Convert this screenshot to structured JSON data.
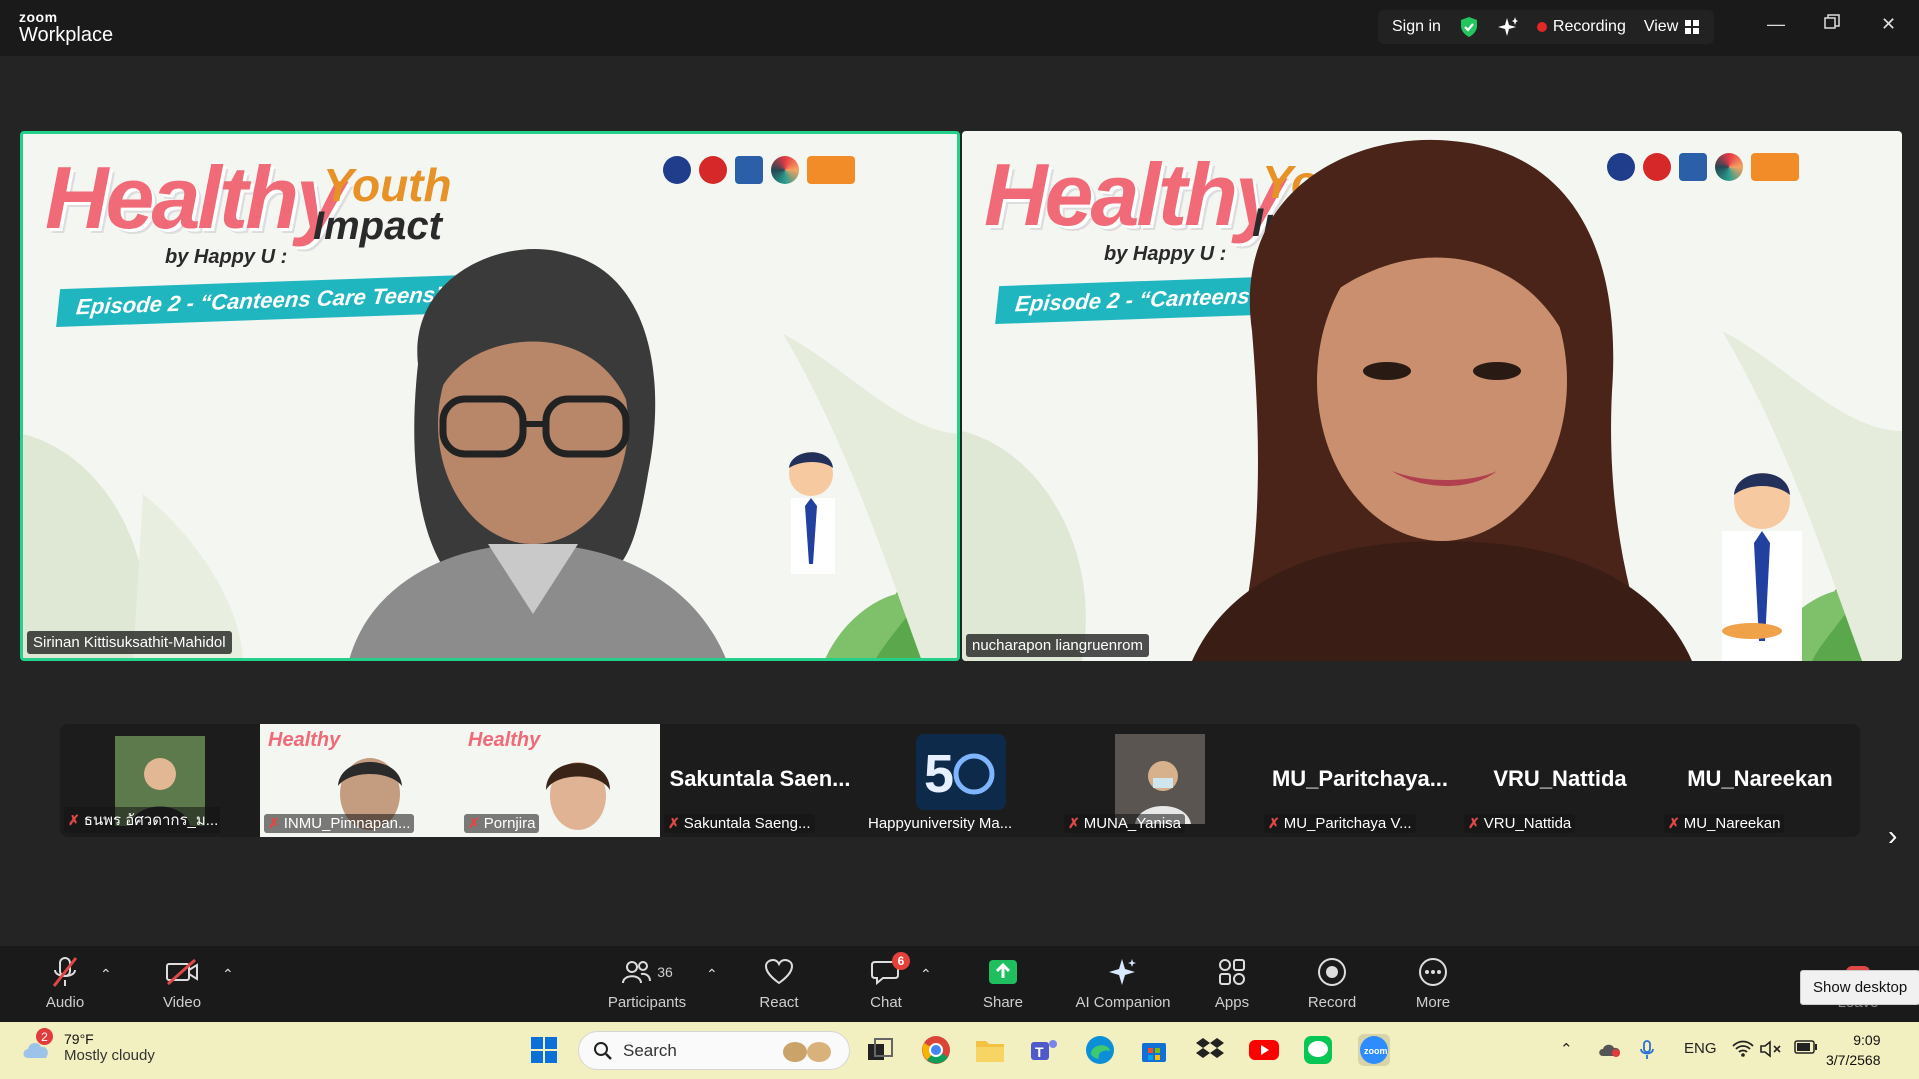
{
  "titlebar": {
    "logo_top": "zoom",
    "logo_bottom": "Workplace",
    "sign_in": "Sign in",
    "recording": "Recording",
    "view": "View"
  },
  "banner": {
    "healthy": "Healthy",
    "youth": "Youth",
    "impact": "Impact",
    "by": "by Happy U :",
    "episode": "Episode 2 - “Canteens Care Teens”"
  },
  "main_tiles": [
    {
      "name": "Sirinan Kittisuksathit-Mahidol",
      "active_speaker": true
    },
    {
      "name": "nucharapon liangruenrom",
      "active_speaker": false
    }
  ],
  "thumbnails": [
    {
      "name": "ธนพร อัศวดากร_ม...",
      "big": ""
    },
    {
      "name": "INMU_Pimnapan...",
      "big": ""
    },
    {
      "name": "Pornjira",
      "big": ""
    },
    {
      "name": "Sakuntala Saeng...",
      "big": "Sakuntala Saen..."
    },
    {
      "name": "Happyuniversity Ma...",
      "big": ""
    },
    {
      "name": "MUNA_Yanisa",
      "big": ""
    },
    {
      "name": "MU_Paritchaya V...",
      "big": "MU_Paritchaya..."
    },
    {
      "name": "VRU_Nattida",
      "big": "VRU_Nattida"
    },
    {
      "name": "MU_Nareekan",
      "big": "MU_Nareekan"
    }
  ],
  "toolbar": {
    "audio": "Audio",
    "video": "Video",
    "participants": "Participants",
    "participants_count": "36",
    "react": "React",
    "chat": "Chat",
    "chat_badge": "6",
    "share": "Share",
    "ai_companion": "AI Companion",
    "apps": "Apps",
    "record": "Record",
    "more": "More",
    "leave": "Leave"
  },
  "tooltip": "Show desktop",
  "taskbar": {
    "weather_badge": "2",
    "temperature": "79°F",
    "condition": "Mostly cloudy",
    "search": "Search",
    "lang": "ENG",
    "time": "9:09",
    "date": "3/7/2568"
  },
  "colors": {
    "active_border": "#23d18b",
    "recording": "#e02828",
    "share": "#1fbf5f",
    "taskbar": "#f2efc0"
  }
}
